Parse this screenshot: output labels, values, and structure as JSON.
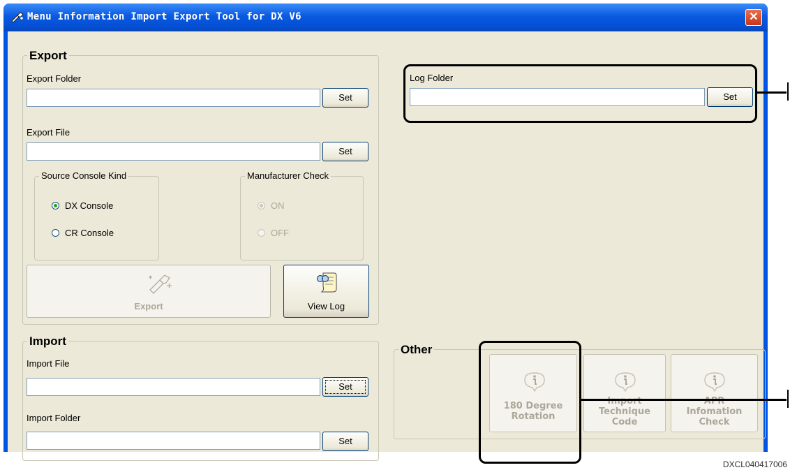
{
  "window": {
    "title": "Menu Information Import Export Tool for DX V6",
    "close_glyph": "✕"
  },
  "export": {
    "legend": "Export",
    "folder_label": "Export Folder",
    "folder_value": "",
    "folder_set": "Set",
    "file_label": "Export File",
    "file_value": "",
    "file_set": "Set",
    "source_legend": "Source Console Kind",
    "source_options": [
      "DX Console",
      "CR Console"
    ],
    "mfr_legend": "Manufacturer Check",
    "mfr_options": [
      "ON",
      "OFF"
    ],
    "export_button": "Export",
    "view_log_button": "View Log"
  },
  "log": {
    "folder_label": "Log Folder",
    "folder_value": "",
    "set": "Set"
  },
  "import": {
    "legend": "Import",
    "file_label": "Import File",
    "file_value": "",
    "file_set": "Set",
    "folder_label": "Import Folder",
    "folder_value": "",
    "folder_set": "Set"
  },
  "other": {
    "legend": "Other",
    "buttons": [
      {
        "line1": "180 Degree",
        "line2": "Rotation",
        "line3": ""
      },
      {
        "line1": "Import",
        "line2": "Technique",
        "line3": "Code"
      },
      {
        "line1": "APR",
        "line2": "Infomation",
        "line3": "Check"
      }
    ]
  },
  "figure_id": "DXCL040417006",
  "icons": [
    "settings-wand-icon",
    "close-icon",
    "export-wand-icon",
    "view-log-icon",
    "info-icon"
  ]
}
